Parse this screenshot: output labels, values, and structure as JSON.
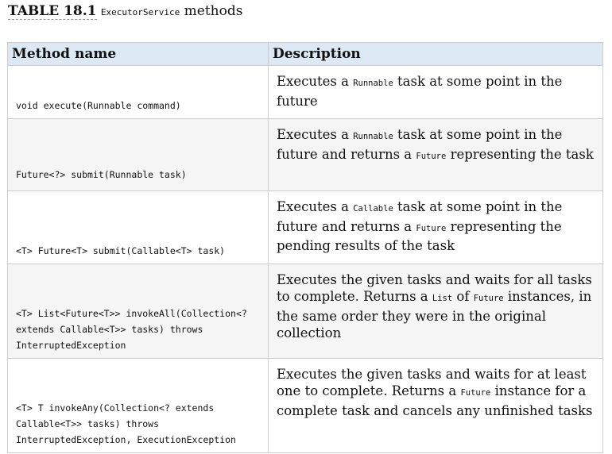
{
  "caption": {
    "number": "TABLE 18.1",
    "code": "ExecutorService",
    "suffix": "methods"
  },
  "table": {
    "headers": {
      "method": "Method name",
      "description": "Description"
    },
    "rows": [
      {
        "signature": "void execute(Runnable command)",
        "description": [
          {
            "t": "Executes a "
          },
          {
            "c": "Runnable"
          },
          {
            "t": " task at some point in the future"
          }
        ]
      },
      {
        "signature": "Future<?> submit(Runnable task)",
        "description": [
          {
            "t": "Executes a "
          },
          {
            "c": "Runnable"
          },
          {
            "t": " task at some point in the future and returns a "
          },
          {
            "c": "Future"
          },
          {
            "t": " representing the task"
          }
        ]
      },
      {
        "signature": "<T> Future<T> submit(Callable<T> task)",
        "description": [
          {
            "t": "Executes a "
          },
          {
            "c": "Callable"
          },
          {
            "t": " task at some point in the future and returns a "
          },
          {
            "c": "Future"
          },
          {
            "t": " representing the pending results of the task"
          }
        ]
      },
      {
        "signature": "<T> List<Future<T>> invokeAll(Collection<? extends Callable<T>> tasks) throws InterruptedException",
        "description": [
          {
            "t": "Executes the given tasks and waits for all tasks to complete. Returns a "
          },
          {
            "c": "List"
          },
          {
            "t": " of "
          },
          {
            "c": "Future"
          },
          {
            "t": " instances, in the same order they were in the original collection"
          }
        ]
      },
      {
        "signature": "<T> T invokeAny(Collection<? extends Callable<T>> tasks) throws InterruptedException, ExecutionException",
        "description": [
          {
            "t": "Executes the given tasks and waits for at least one to complete. Returns a "
          },
          {
            "c": "Future"
          },
          {
            "t": " instance for a complete task and cancels any unfinished tasks"
          }
        ]
      }
    ]
  }
}
